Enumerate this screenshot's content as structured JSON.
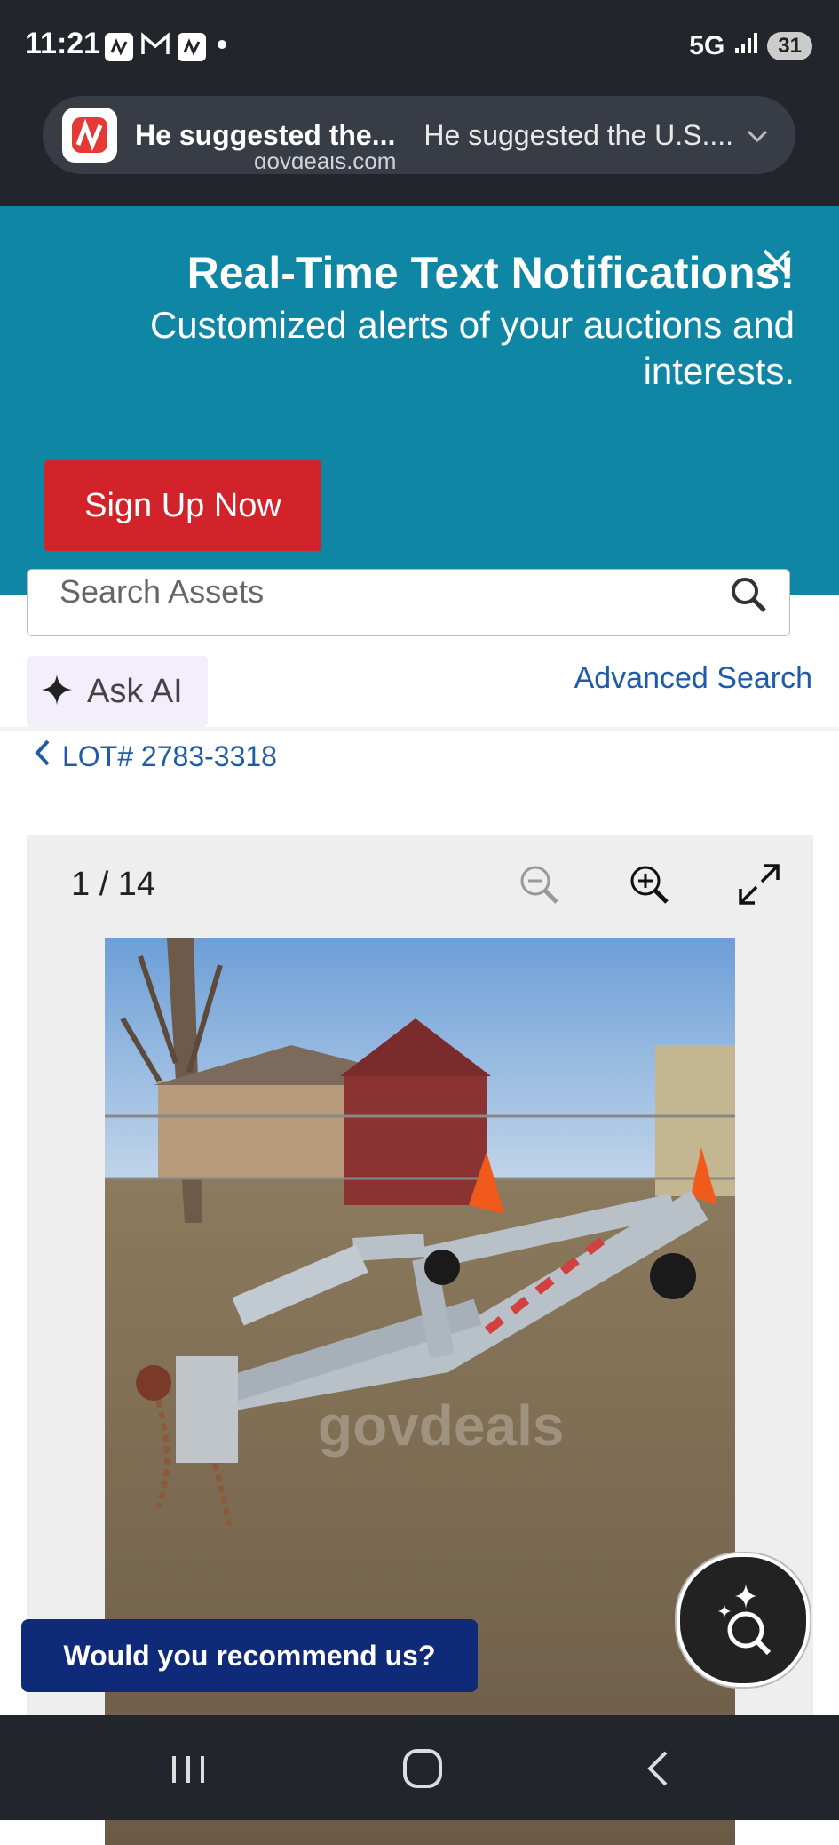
{
  "status_bar": {
    "time": "11:21",
    "network": "5G",
    "battery": "31"
  },
  "notification": {
    "title": "He suggested the...",
    "body": "He suggested the U.S...."
  },
  "browser": {
    "url_peek": "govdeals.com"
  },
  "banner": {
    "title": "Real-Time Text Notifications!",
    "subtitle": "Customized alerts of your auctions and interests.",
    "signup_label": "Sign Up Now",
    "color": "#0f86a3"
  },
  "search": {
    "placeholder": "Search Assets",
    "ask_ai_label": "Ask AI",
    "advanced_label": "Advanced Search"
  },
  "lot": {
    "label": "LOT# 2783-3318"
  },
  "gallery": {
    "counter": "1 / 14",
    "watermark": "govdeals"
  },
  "feedback": {
    "label": "Would you recommend us?"
  },
  "colors": {
    "accent_red": "#d2232a",
    "link_blue": "#1f5ba8",
    "navy": "#0e2a78"
  }
}
